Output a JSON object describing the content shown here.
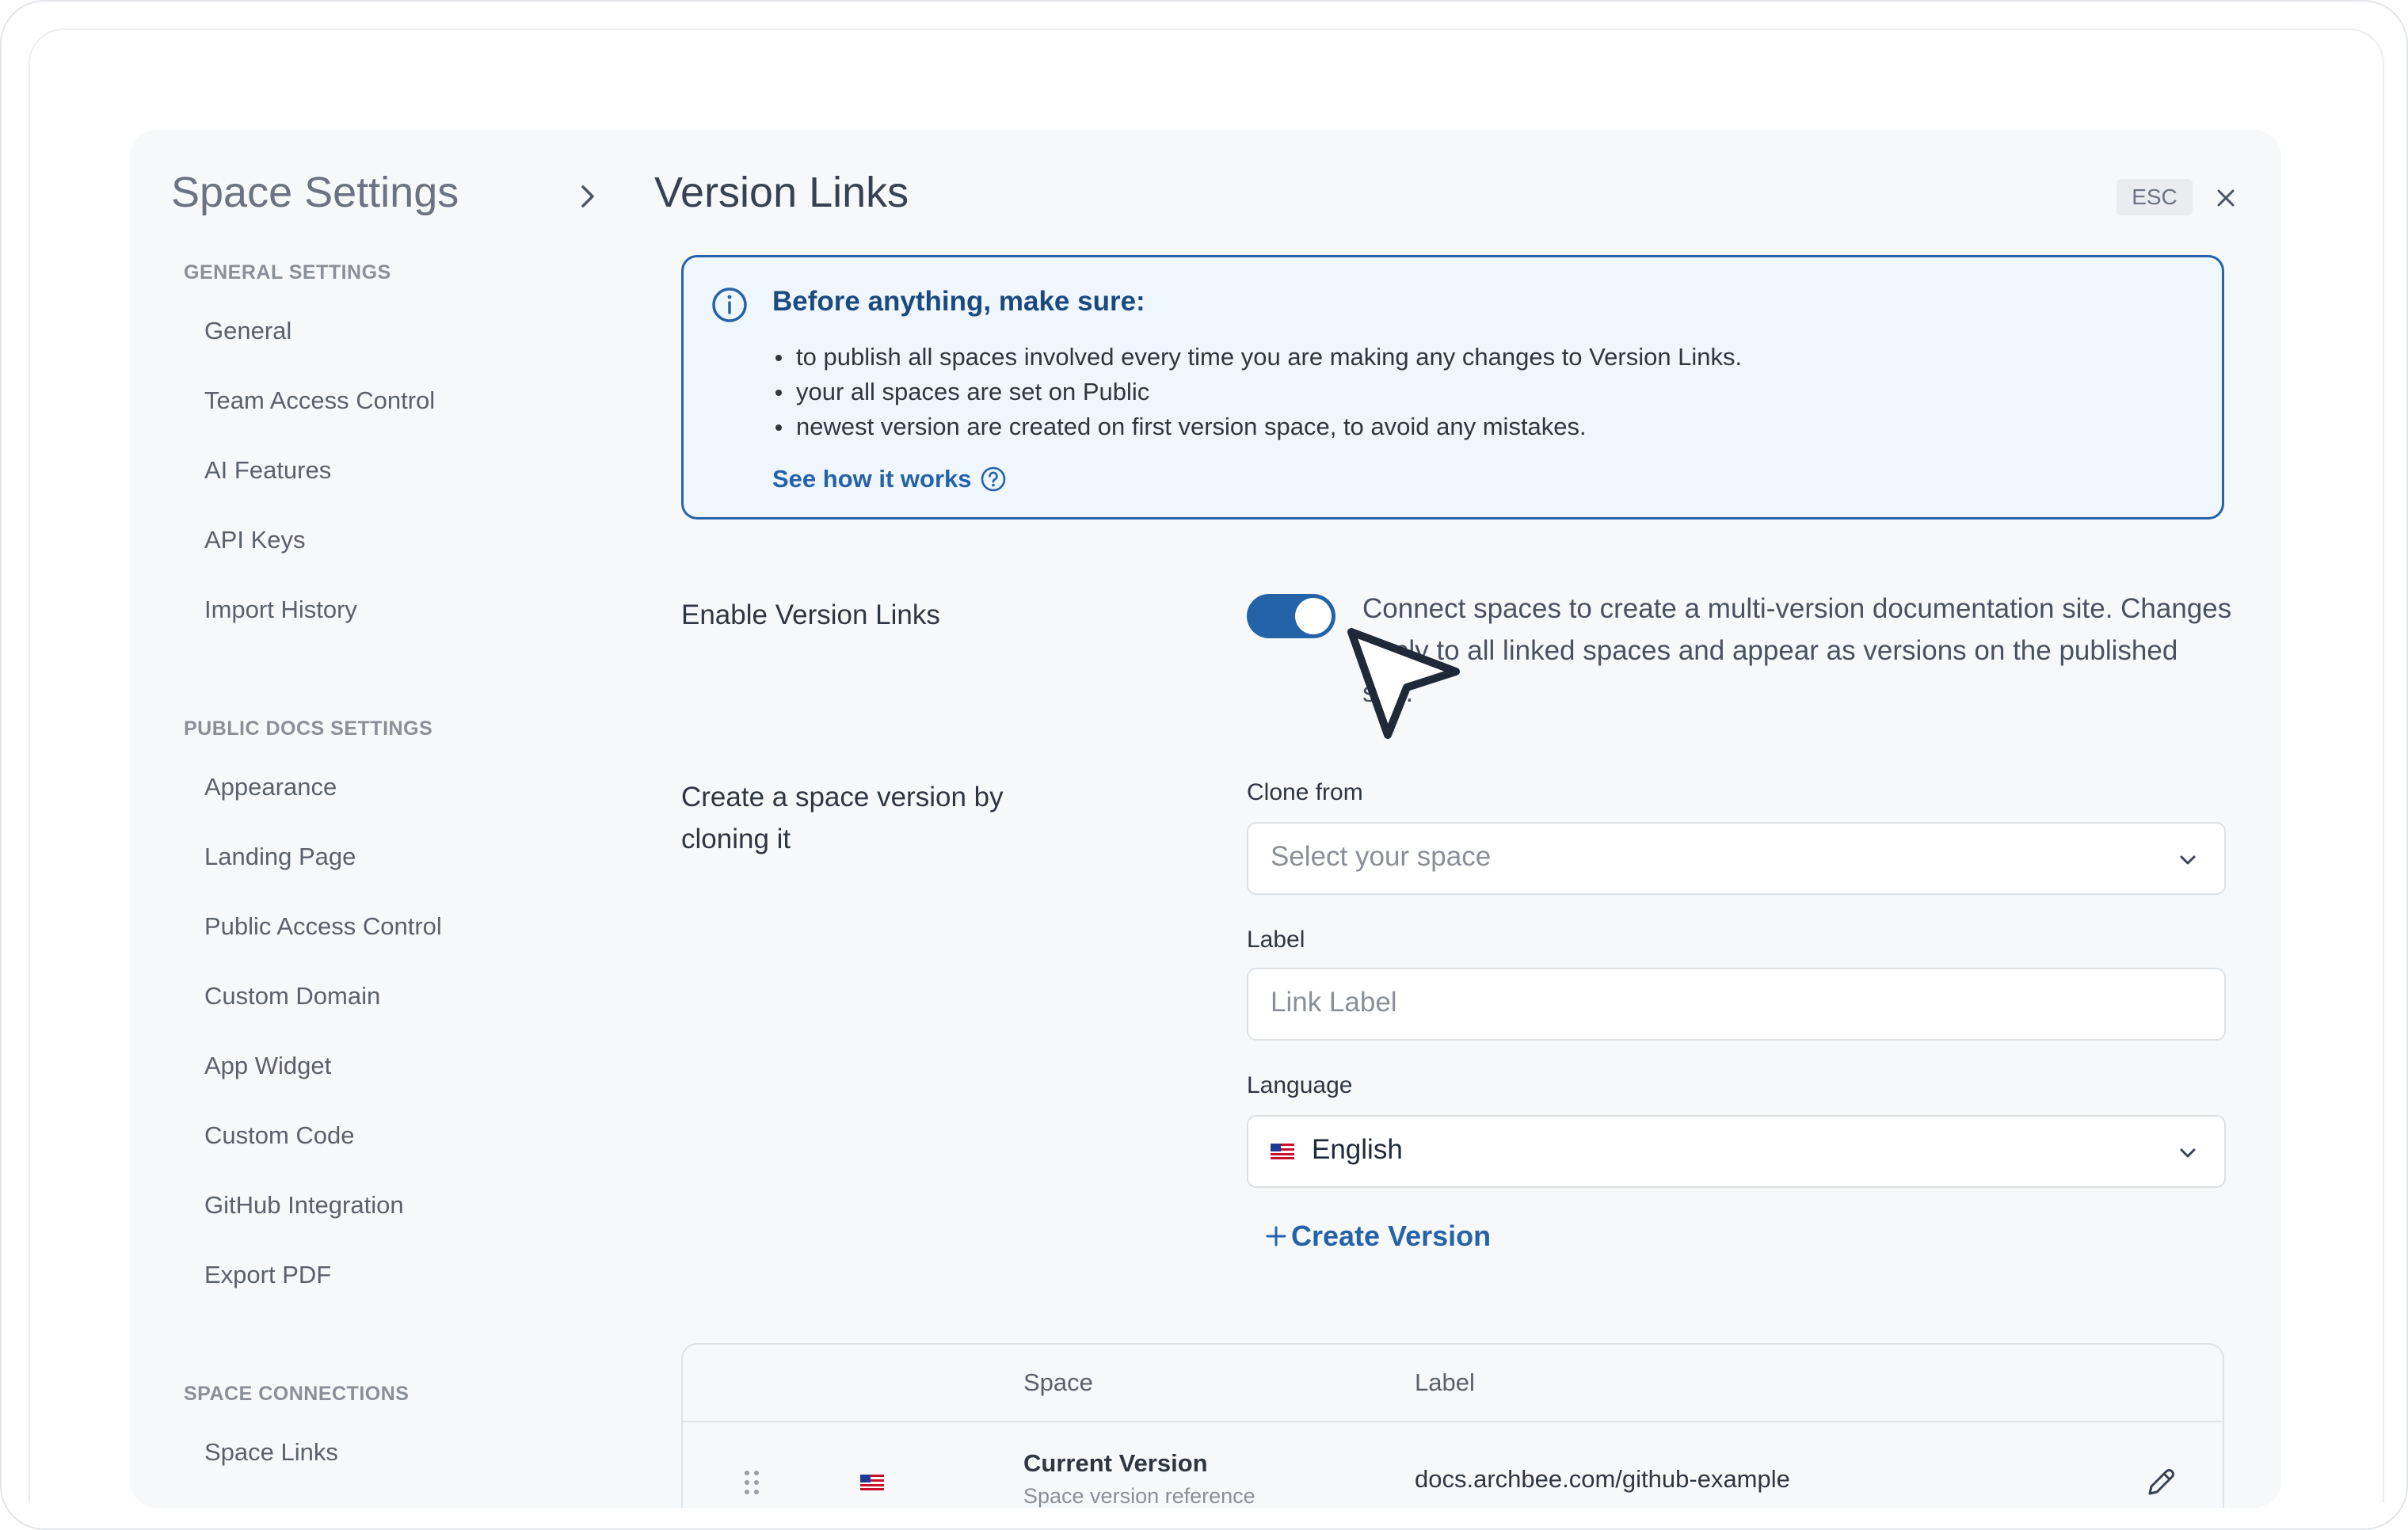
{
  "sidebar": {
    "title": "Space Settings",
    "sections": [
      {
        "label": "GENERAL SETTINGS",
        "items": [
          "General",
          "Team Access Control",
          "AI Features",
          "API Keys",
          "Import History"
        ]
      },
      {
        "label": "PUBLIC DOCS SETTINGS",
        "items": [
          "Appearance",
          "Landing Page",
          "Public Access Control",
          "Custom Domain",
          "App Widget",
          "Custom Code",
          "GitHub Integration",
          "Export PDF"
        ]
      },
      {
        "label": "SPACE CONNECTIONS",
        "items": [
          "Space Links"
        ]
      }
    ]
  },
  "header": {
    "title": "Version Links",
    "esc_label": "ESC"
  },
  "notice": {
    "title": "Before anything, make sure:",
    "bullets": [
      "to publish all spaces involved every time you are making any changes to Version Links.",
      "your all spaces are set on Public",
      "newest version are created on first version space, to avoid any mistakes."
    ],
    "link_label": "See how it works"
  },
  "enable": {
    "label": "Enable Version Links",
    "enabled": true,
    "description": "Connect spaces to create a multi-version documentation site. Changes apply to all linked spaces and appear as versions on the published site."
  },
  "clone": {
    "label": "Create a space version by cloning it",
    "clone_from_label": "Clone from",
    "clone_from_placeholder": "Select your space",
    "label_field_label": "Label",
    "label_placeholder": "Link Label",
    "language_label": "Language",
    "language_value": "English",
    "create_button": "Create Version"
  },
  "table": {
    "columns": [
      "Space",
      "Label"
    ],
    "rows": [
      {
        "space": "Current Version",
        "space_sub": "Space version reference",
        "label": "docs.archbee.com/github-example"
      }
    ]
  },
  "colors": {
    "accent": "#2563a8",
    "notice_bg": "#f0f6fd",
    "modal_bg": "#f7f8fa"
  },
  "icons": [
    "chevron-right-icon",
    "close-icon",
    "info-icon",
    "help-circle-icon",
    "chevron-down-icon",
    "flag-us-icon",
    "plus-icon",
    "drag-handle-icon",
    "pencil-icon",
    "cursor-icon"
  ]
}
